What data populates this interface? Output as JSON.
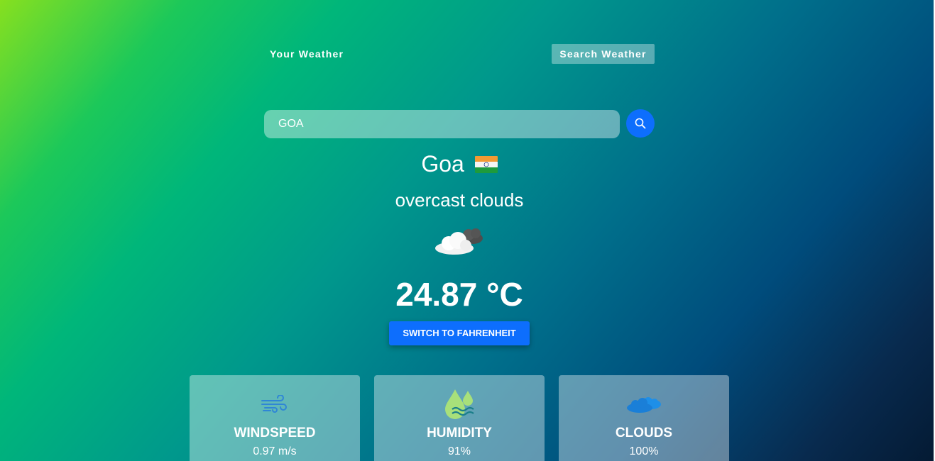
{
  "nav": {
    "tabs": [
      {
        "label": "Your Weather"
      },
      {
        "label": "Search Weather"
      }
    ]
  },
  "search": {
    "value": "GOA",
    "icon": "search-icon"
  },
  "location": {
    "city": "Goa",
    "flag_icon": "india-flag-icon"
  },
  "weather": {
    "description": "overcast clouds",
    "icon": "overcast-clouds-icon",
    "temperature": "24.87 °C"
  },
  "switch_button": {
    "label": "SWITCH TO FAHRENHEIT"
  },
  "stats": [
    {
      "title": "WINDSPEED",
      "value": "0.97 m/s",
      "icon": "wind-icon"
    },
    {
      "title": "HUMIDITY",
      "value": "91%",
      "icon": "humidity-drops-icon"
    },
    {
      "title": "CLOUDS",
      "value": "100%",
      "icon": "clouds-icon"
    }
  ],
  "colors": {
    "accent": "#0d6efd",
    "wind_icon": "#2f86d6",
    "humidity_icon": "#a8e07a",
    "clouds_icon": "#1e8fe8"
  }
}
